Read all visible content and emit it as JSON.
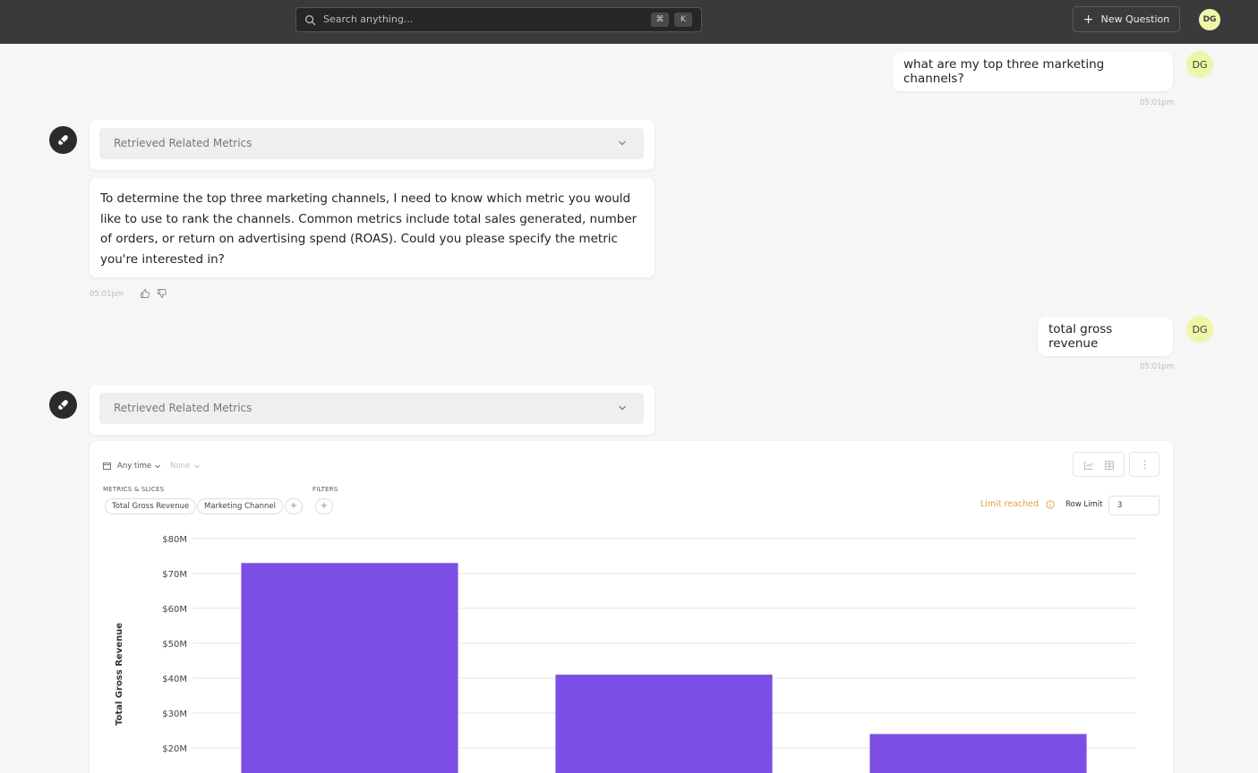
{
  "topbar": {
    "search_placeholder": "Search anything...",
    "kbd_cmd": "⌘",
    "kbd_k": "K",
    "new_question": "New Question",
    "avatar": "DG"
  },
  "conversation": [
    {
      "role": "user",
      "text": "what are my top three marketing channels?",
      "time": "05:01pm",
      "avatar": "DG"
    },
    {
      "role": "assistant",
      "retrieved_label": "Retrieved Related Metrics",
      "text": "To determine the top three marketing channels, I need to know which metric you would like to use to rank the channels. Common metrics include total sales generated, number of orders, or return on advertising spend (ROAS). Could you please specify the metric you're interested in?",
      "time": "05:01pm"
    },
    {
      "role": "user",
      "text": "total gross revenue",
      "time": "05:01pm",
      "avatar": "DG"
    },
    {
      "role": "assistant",
      "retrieved_label": "Retrieved Related Metrics"
    }
  ],
  "chart_panel": {
    "time_filter": "Any time",
    "granularity": "None",
    "metrics_caption": "METRICS & SLICES",
    "filters_caption": "FILTERS",
    "chips": [
      "Total Gross Revenue",
      "Marketing Channel"
    ],
    "limit_reached": "Limit reached",
    "row_limit_label": "Row Limit",
    "row_limit_value": "3"
  },
  "chart_data": {
    "type": "bar",
    "ylabel": "Total Gross Revenue",
    "yticks": [
      "$20M",
      "$30M",
      "$40M",
      "$50M",
      "$60M",
      "$70M",
      "$80M"
    ],
    "ylim": [
      0,
      80
    ],
    "unit": "$M",
    "values": [
      73,
      41,
      24
    ],
    "grid": true,
    "bar_color": "#7b4fe6"
  }
}
